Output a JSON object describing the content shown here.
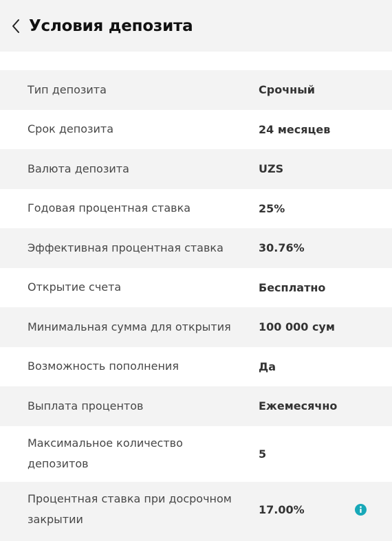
{
  "header": {
    "title": "Условия депозита",
    "back_icon": "chevron-left-icon"
  },
  "rows": [
    {
      "label": "Тип депозита",
      "value": "Срочный"
    },
    {
      "label": "Срок депозита",
      "value": "24 месяцев"
    },
    {
      "label": "Валюта депозита",
      "value": "UZS"
    },
    {
      "label": "Годовая процентная ставка",
      "value": "25%"
    },
    {
      "label": "Эффективная процентная ставка",
      "value": "30.76%"
    },
    {
      "label": "Открытие счета",
      "value": "Бесплатно"
    },
    {
      "label": "Минимальная сумма для открытия",
      "value": "100 000 сум"
    },
    {
      "label": "Возможность пополнения",
      "value": "Да"
    },
    {
      "label": "Выплата процентов",
      "value": "Ежемесячно"
    },
    {
      "label": "Максимальное количество депозитов",
      "value": "5"
    },
    {
      "label": "Процентная ставка при досрочном закрытии",
      "value": "17.00%",
      "icon": "info-icon"
    }
  ],
  "colors": {
    "accent": "#17a8b8",
    "row_alt": "#f3f3f3",
    "row_base": "#ffffff"
  }
}
